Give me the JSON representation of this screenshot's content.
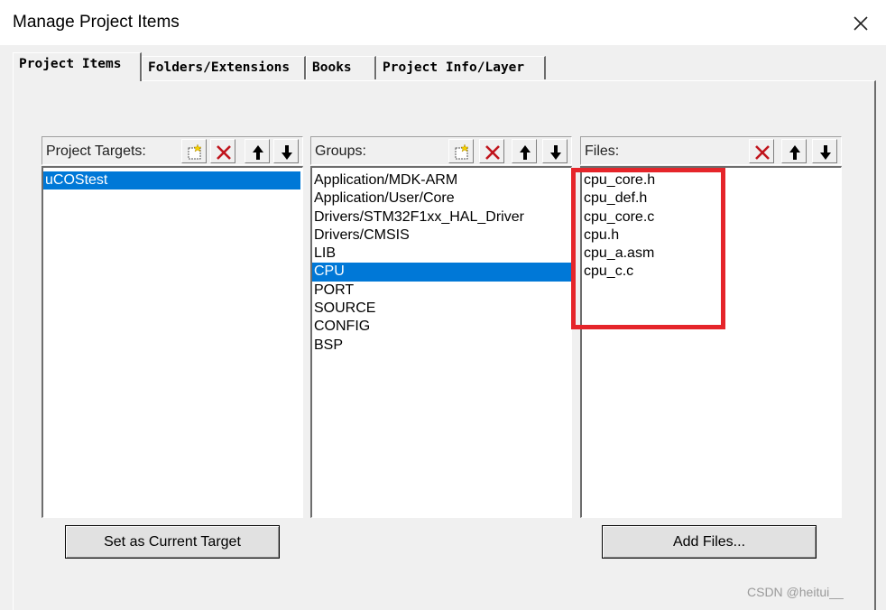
{
  "window": {
    "title": "Manage Project Items"
  },
  "tabs": [
    {
      "label": "Project Items"
    },
    {
      "label": "Folders/Extensions"
    },
    {
      "label": "Books"
    },
    {
      "label": "Project Info/Layer"
    }
  ],
  "targets": {
    "label": "Project Targets:",
    "items": [
      "uCOStest"
    ],
    "selected": "uCOStest",
    "button": "Set as Current Target"
  },
  "groups": {
    "label": "Groups:",
    "items": [
      "Application/MDK-ARM",
      "Application/User/Core",
      "Drivers/STM32F1xx_HAL_Driver",
      "Drivers/CMSIS",
      "LIB",
      "CPU",
      "PORT",
      "SOURCE",
      "CONFIG",
      "BSP"
    ],
    "selected": "CPU"
  },
  "files": {
    "label": "Files:",
    "items": [
      "cpu_core.h",
      "cpu_def.h",
      "cpu_core.c",
      "cpu.h",
      "cpu_a.asm",
      "cpu_c.c"
    ],
    "button": "Add Files..."
  },
  "watermark": "CSDN @heitui__",
  "colors": {
    "selection": "#0078d7",
    "highlight_box": "#e5252a",
    "delete_icon": "#c0141c"
  }
}
